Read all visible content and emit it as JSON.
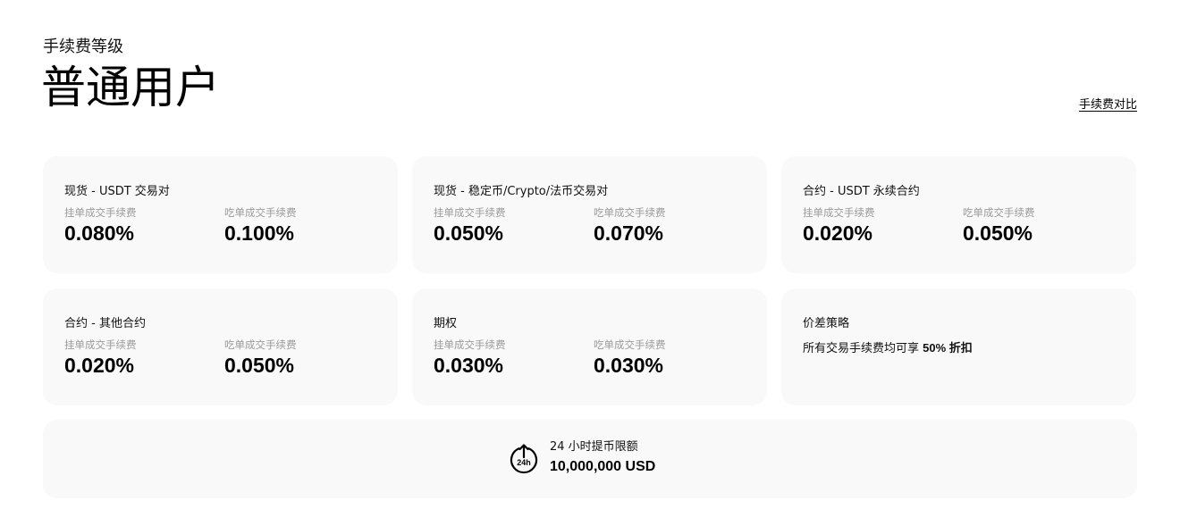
{
  "header": {
    "subtitle": "手续费等级",
    "title": "普通用户",
    "compare_link": "手续费对比"
  },
  "cards": [
    {
      "title": "现货 - USDT 交易对",
      "maker_label": "挂单成交手续费",
      "maker_value": "0.080%",
      "taker_label": "吃单成交手续费",
      "taker_value": "0.100%"
    },
    {
      "title": "现货 - 稳定币/Crypto/法币交易对",
      "maker_label": "挂单成交手续费",
      "maker_value": "0.050%",
      "taker_label": "吃单成交手续费",
      "taker_value": "0.070%"
    },
    {
      "title": "合约 - USDT 永续合约",
      "maker_label": "挂单成交手续费",
      "maker_value": "0.020%",
      "taker_label": "吃单成交手续费",
      "taker_value": "0.050%"
    },
    {
      "title": "合约 - 其他合约",
      "maker_label": "挂单成交手续费",
      "maker_value": "0.020%",
      "taker_label": "吃单成交手续费",
      "taker_value": "0.050%"
    },
    {
      "title": "期权",
      "maker_label": "挂单成交手续费",
      "maker_value": "0.030%",
      "taker_label": "吃单成交手续费",
      "taker_value": "0.030%"
    }
  ],
  "spread": {
    "title": "价差策略",
    "desc_prefix": "所有交易手续费均可享 ",
    "desc_highlight": "50% 折扣"
  },
  "withdraw": {
    "icon": "24h-withdraw-icon",
    "icon_text": "24h",
    "label": "24 小时提币限额",
    "value": "10,000,000 USD"
  }
}
